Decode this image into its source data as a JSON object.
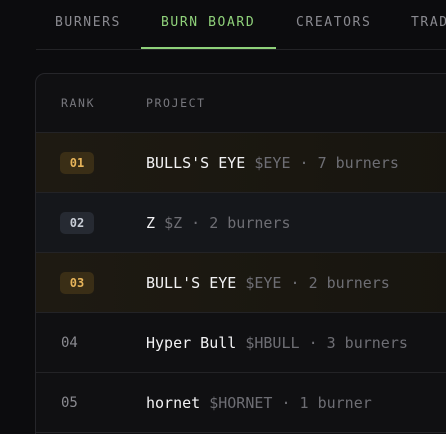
{
  "tabs": [
    {
      "label": "BURNERS",
      "active": false
    },
    {
      "label": "BURN BOARD",
      "active": true
    },
    {
      "label": "CREATORS",
      "active": false
    },
    {
      "label": "TRAD",
      "active": false
    }
  ],
  "table": {
    "headers": {
      "rank": "RANK",
      "project": "PROJECT"
    },
    "rows": [
      {
        "rank": "01",
        "name": "BULLS'S EYE",
        "ticker": "$EYE",
        "sep": "·",
        "burners": "7 burners",
        "tier": "gold"
      },
      {
        "rank": "02",
        "name": "Z",
        "ticker": "$Z",
        "sep": "·",
        "burners": "2 burners",
        "tier": "silver"
      },
      {
        "rank": "03",
        "name": "BULL'S EYE",
        "ticker": "$EYE",
        "sep": "·",
        "burners": "2 burners",
        "tier": "gold"
      },
      {
        "rank": "04",
        "name": "Hyper Bull",
        "ticker": "$HBULL",
        "sep": "·",
        "burners": "3 burners",
        "tier": "none"
      },
      {
        "rank": "05",
        "name": "hornet",
        "ticker": "$HORNET",
        "sep": "·",
        "burners": "1 burner",
        "tier": "none"
      }
    ]
  },
  "colors": {
    "accent": "#8fd17a",
    "gold": "#e7b45a",
    "background": "#0c0c0e"
  }
}
